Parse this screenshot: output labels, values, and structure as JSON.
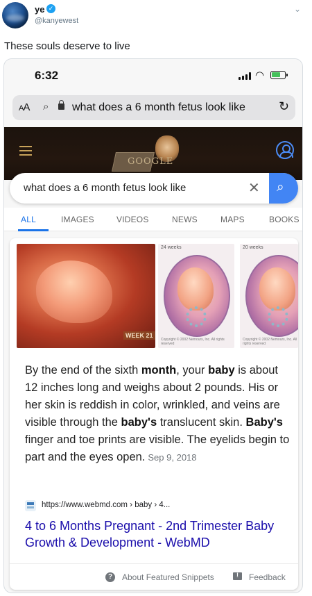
{
  "tweet": {
    "display_name": "ye",
    "handle": "@kanyewest",
    "text": "These souls deserve to live"
  },
  "phone": {
    "time": "6:32",
    "address_text": "what does a 6 month fetus look like",
    "aa_label": "AA"
  },
  "google": {
    "doodle_word": "GOOGLE",
    "search_query": "what does a 6 month fetus look like",
    "tabs": [
      "ALL",
      "IMAGES",
      "VIDEOS",
      "NEWS",
      "MAPS",
      "BOOKS"
    ],
    "active_tab": "ALL",
    "accent_color": "#1a73e8"
  },
  "result": {
    "images": {
      "main_overlay": "WEEK 21",
      "thumb1_label": "24 weeks",
      "thumb2_label": "20 weeks",
      "copyright": "Copyright © 2002 Nemours, Inc. All rights reserved"
    },
    "snippet": {
      "p1": "By the end of the sixth ",
      "b1": "month",
      "p2": ", your ",
      "b2": "baby",
      "p3": " is about 12 inches long and weighs about 2 pounds. His or her skin is reddish in color, wrinkled, and veins are visible through the ",
      "b3": "baby's",
      "p4": " translucent skin. ",
      "b4": "Baby's",
      "p5": " finger and toe prints are visible. The eyelids begin to part and the eyes open.",
      "date": "Sep 9, 2018"
    },
    "source_url": "https://www.webmd.com › baby › 4...",
    "title": "4 to 6 Months Pregnant - 2nd Trimester Baby Growth & Development - WebMD",
    "about_label": "About Featured Snippets",
    "feedback_label": "Feedback"
  }
}
